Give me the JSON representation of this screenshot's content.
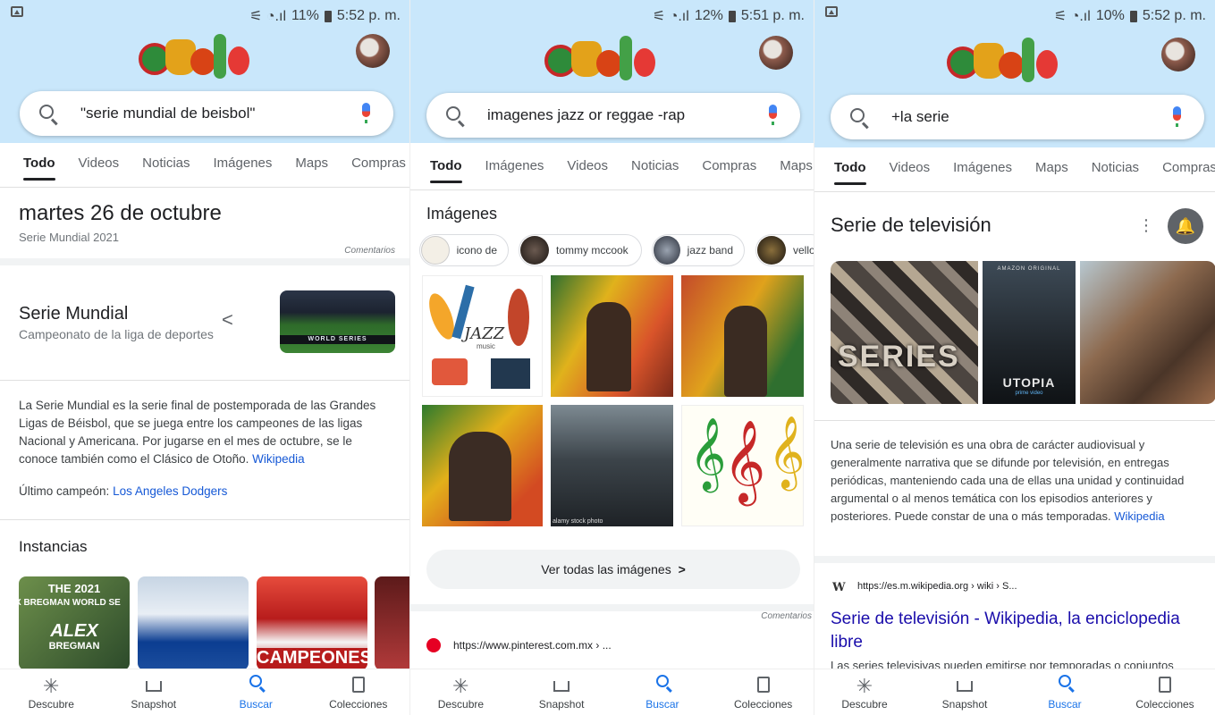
{
  "panels": [
    {
      "status": {
        "battery": "11%",
        "time": "5:52 p. m."
      },
      "search": {
        "query": "\"serie mundial de beisbol\""
      },
      "tabs": [
        "Todo",
        "Videos",
        "Noticias",
        "Imágenes",
        "Maps",
        "Compras"
      ],
      "date": {
        "title": "martes 26 de octubre",
        "subtitle": "Serie Mundial 2021",
        "comments": "Comentarios"
      },
      "entity": {
        "title": "Serie Mundial",
        "subtitle": "Campeonato de la liga de deportes",
        "image_text": "WORLD SERIES"
      },
      "description": {
        "text": "La Serie Mundial es la serie final de postemporada de las Grandes Ligas de Béisbol, que se juega entre los campeones de las ligas Nacional y Americana. Por jugarse en el mes de octubre, se le conoce también como el Clásico de Otoño.",
        "source": "Wikipedia"
      },
      "champion": {
        "label": "Último campeón:",
        "value": "Los Angeles Dodgers"
      },
      "instances": {
        "title": "Instancias",
        "thumb1_top": "THE 2021",
        "thumb1_mid": "X BREGMAN WORLD SE",
        "thumb1_name": "ALEX",
        "thumb1_name2": "BREGMAN",
        "thumb3_text": "CAMPEONES"
      }
    },
    {
      "status": {
        "battery": "12%",
        "time": "5:51 p. m."
      },
      "search": {
        "query": "imagenes jazz or reggae -rap"
      },
      "tabs": [
        "Todo",
        "Imágenes",
        "Videos",
        "Noticias",
        "Compras",
        "Maps"
      ],
      "images_title": "Imágenes",
      "chips": [
        "icono de",
        "tommy mccook",
        "jazz band",
        "vello"
      ],
      "grid_texts": {
        "jazz": "JAZZ",
        "music": "music",
        "stock": "alamy stock photo"
      },
      "see_all": "Ver todas las imágenes",
      "comments": "Comentarios",
      "result_url": "https://www.pinterest.com.mx › ..."
    },
    {
      "status": {
        "battery": "10%",
        "time": "5:52 p. m."
      },
      "search": {
        "query": "+la serie"
      },
      "tabs": [
        "Todo",
        "Videos",
        "Imágenes",
        "Maps",
        "Noticias",
        "Compras"
      ],
      "entity_title": "Serie de televisión",
      "more_icon": "⋮",
      "img_texts": {
        "series": "SERIES",
        "amazon": "AMAZON ORIGINAL",
        "utopia": "UTOPIA",
        "prime": "prime video"
      },
      "description": {
        "text": "Una serie de televisión es una obra de carácter audiovisual y generalmente narrativa que se difunde por televisión, en entregas periódicas, manteniendo cada una de ellas una unidad y continuidad argumental o al menos temática con los episodios anteriores y posteriores. Puede constar de una o más temporadas.",
        "source": "Wikipedia"
      },
      "result": {
        "favicon": "W",
        "url": "https://es.m.wikipedia.org › wiki › S...",
        "title": "Serie de televisión - Wikipedia, la enciclopedia libre",
        "snippet": "Las series televisivas pueden emitirse por temporadas o conjuntos"
      }
    }
  ],
  "bottom_nav": [
    "Descubre",
    "Snapshot",
    "Buscar",
    "Colecciones"
  ],
  "colors": {
    "accent": "#1a73e8",
    "hero": "#c9e7fb",
    "link": "#1a0dab"
  }
}
